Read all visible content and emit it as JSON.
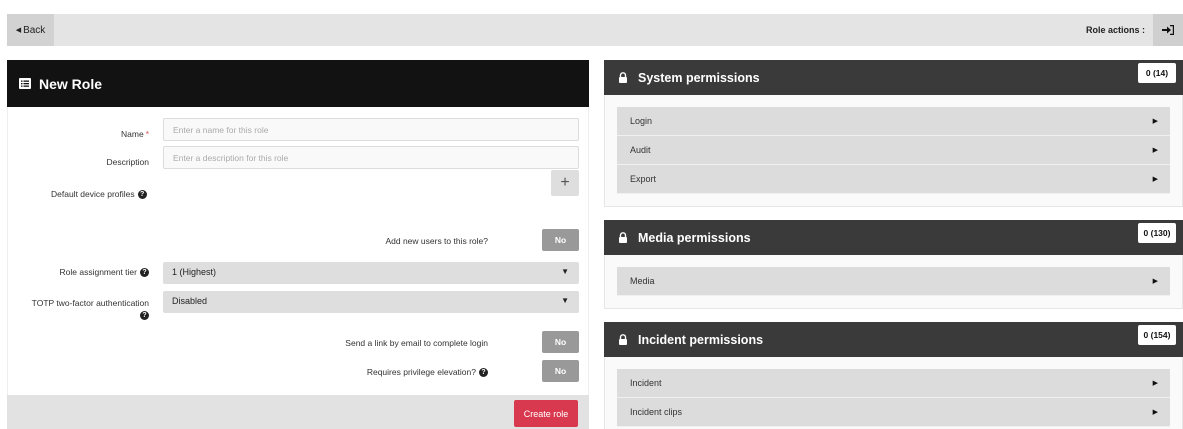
{
  "topbar": {
    "back_label": "Back",
    "role_actions_label": "Role actions :"
  },
  "form": {
    "title": "New Role",
    "name_label": "Name",
    "name_required_mark": "*",
    "name_placeholder": "Enter a name for this role",
    "description_label": "Description",
    "description_placeholder": "Enter a description for this role",
    "default_profiles_label": "Default device profiles",
    "add_new_users_label": "Add new users to this role?",
    "add_new_users_value": "No",
    "assignment_tier_label": "Role assignment tier",
    "assignment_tier_value": "1 (Highest)",
    "totp_label": "TOTP two-factor authentication",
    "totp_value": "Disabled",
    "email_link_label": "Send a link by email to complete login",
    "email_link_value": "No",
    "privilege_elevation_label": "Requires privilege elevation?",
    "privilege_elevation_value": "No",
    "create_button_label": "Create role"
  },
  "permissions": [
    {
      "title": "System permissions",
      "count": "0 (14)",
      "items": [
        "Login",
        "Audit",
        "Export"
      ]
    },
    {
      "title": "Media permissions",
      "count": "0 (130)",
      "items": [
        "Media"
      ]
    },
    {
      "title": "Incident permissions",
      "count": "0 (154)",
      "items": [
        "Incident",
        "Incident clips"
      ]
    }
  ],
  "colors": {
    "accent": "#d9394e",
    "header_dark": "#121212",
    "perm_header": "#3a3a3a"
  },
  "icons": {
    "back": "caret-left-icon",
    "role_actions": "sign-in-icon",
    "form_title": "list-alt-icon",
    "help": "question-circle-icon",
    "lock": "lock-icon",
    "expand": "caret-right-icon"
  }
}
